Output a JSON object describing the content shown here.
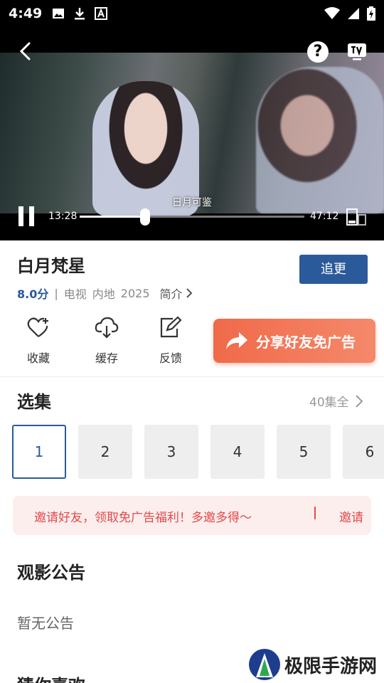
{
  "status_bar": {
    "time": "4:49",
    "icons": [
      "image-icon",
      "download-icon",
      "a-letter-icon"
    ],
    "right_icons": [
      "wifi-icon",
      "signal-icon",
      "battery-charging-icon"
    ]
  },
  "player": {
    "subtitle": "日月可鉴",
    "current_time": "13:28",
    "total_time": "47:12",
    "progress": 0.29,
    "help_label": "?"
  },
  "show": {
    "title": "白月梵星",
    "follow_label": "追更",
    "score": "8.0分",
    "separator": "|",
    "type": "电视",
    "region": "内地",
    "year": "2025",
    "intro_label": "简介"
  },
  "actions": {
    "favorite": "收藏",
    "cache": "缓存",
    "feedback": "反馈",
    "share_banner": "分享好友免广告"
  },
  "episodes": {
    "title": "选集",
    "total": "40集全",
    "items": [
      "1",
      "2",
      "3",
      "4",
      "5",
      "6"
    ],
    "selected": "1"
  },
  "invite": {
    "text": "邀请好友，领取免广告福利！多邀多得～",
    "link": "邀请"
  },
  "notice": {
    "title": "观影公告",
    "text": "暂无公告"
  },
  "recommend": {
    "title": "猜你喜欢"
  },
  "watermark": {
    "text": "极限手游网"
  },
  "colors": {
    "accent": "#2b5a9a",
    "invite_bg": "#fdeeee",
    "invite_text": "#e14a4a",
    "share_banner": "#f06a4a"
  }
}
